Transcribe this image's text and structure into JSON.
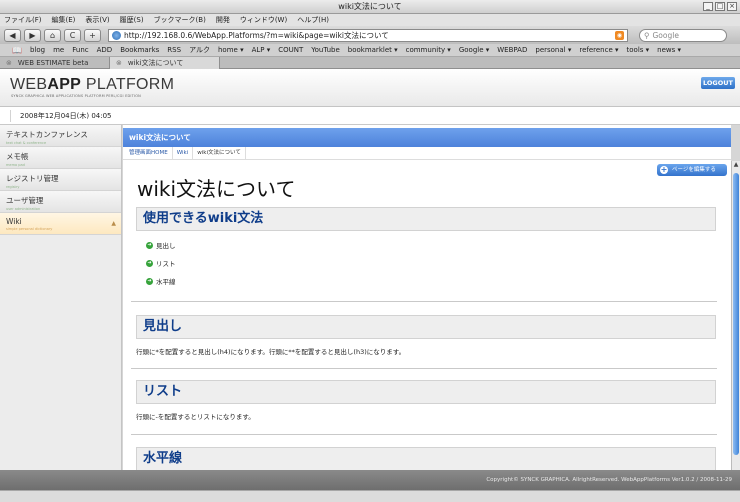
{
  "window": {
    "title": "wiki文法について"
  },
  "menu": [
    "ファイル(F)",
    "編集(E)",
    "表示(V)",
    "履歴(S)",
    "ブックマーク(B)",
    "開発",
    "ウィンドウ(W)",
    "ヘルプ(H)"
  ],
  "toolbar": {
    "back": "◀",
    "forward": "▶",
    "home": "⌂",
    "reload": "C",
    "add": "+",
    "url": "http://192.168.0.6/WebApp.Platforms/?m=wiki&page=wiki文法について",
    "search_placeholder": "Google"
  },
  "bookmarks": [
    "blog",
    "me",
    "Func",
    "ADD",
    "Bookmarks",
    "RSS",
    "アルク",
    "home ▾",
    "ALP ▾",
    "COUNT",
    "YouTube",
    "bookmarklet ▾",
    "community ▾",
    "Google ▾",
    "WEBPAD",
    "personal ▾",
    "reference ▾",
    "tools ▾",
    "news ▾"
  ],
  "tabs": [
    {
      "label": "WEB ESTIMATE beta"
    },
    {
      "label": "wiki文法について"
    }
  ],
  "app": {
    "logo_light": "WEB",
    "logo_bold": "APP",
    "logo_rest": " PLATFORM",
    "logo_sub": "SYNCK GRAPHICA WEB APPLICATIONS PLATFORM  PERL/CGI EDITION",
    "logout": "LOGOUT",
    "date": "2008年12月04日(木) 04:05"
  },
  "sidebar": {
    "items": [
      {
        "label": "テキストカンファレンス",
        "sub": "text chat & conference"
      },
      {
        "label": "メモ帳",
        "sub": "memo pad"
      },
      {
        "label": "レジストリ管理",
        "sub": "registry"
      },
      {
        "label": "ユーザ管理",
        "sub": "user administration"
      },
      {
        "label": "Wiki",
        "sub": "simple personal dictionary"
      }
    ]
  },
  "main": {
    "section_title": "wiki文法について",
    "breadcrumb": [
      "管理画面HOME",
      "Wiki",
      "wiki文法について"
    ],
    "edit_button": "ページを編集する",
    "page_title": "wiki文法について",
    "h2_1": "使用できるwiki文法",
    "list": [
      "見出し",
      "リスト",
      "水平線"
    ],
    "h2_2": "見出し",
    "p_2": "行頭に*を配置すると見出し(h4)になります。行頭に**を配置すると見出し(h3)になります。",
    "h2_3": "リスト",
    "p_3": "行頭に-を配置するとリストになります。",
    "h2_4": "水平線"
  },
  "footer": {
    "text": "Copyright© SYNCK GRAPHICA. AllrightReserved. WebAppPlatforms Ver1.0.2 / 2008-11-29"
  },
  "colors": {
    "accent": "#4d82db",
    "heading": "#0f3d8a",
    "bullet": "#36a33b"
  }
}
